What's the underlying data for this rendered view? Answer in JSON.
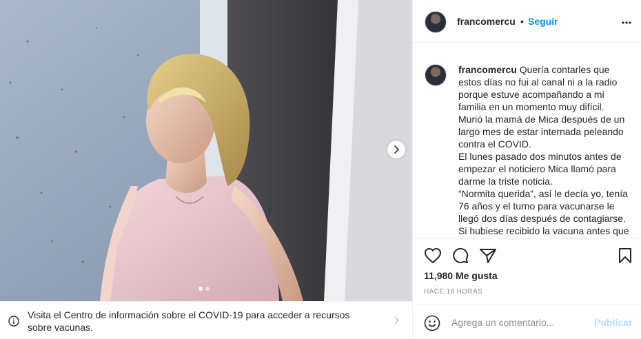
{
  "post": {
    "media": {
      "carousel_dots": 2,
      "active_dot": 0
    },
    "covid_banner": {
      "text": "Visita el Centro de información sobre el COVID-19 para acceder a recursos sobre vacunas."
    }
  },
  "header": {
    "username": "francomercu",
    "separator": "•",
    "follow_label": "Seguir"
  },
  "caption": {
    "username": "francomercu",
    "lines": [
      "Quería contarles que estos días no fui al canal ni a la radio porque estuve acompañando a mi familia en un momento muy difícil.",
      "Murió la mamá de Mica después de un largo mes de estar internada peleando contra el COVID.",
      "El lunes pasado dos minutos antes de empezar el noticiero Mica llamó para darme la triste noticia.",
      "“Normita querida”, así le decía yo, tenía 76 años y el turno para vacunarse le llegó dos días después de contagiarse.",
      "Si hubiese recibido la vacuna antes que"
    ]
  },
  "engagement": {
    "likes": "11,980 Me gusta",
    "time": "HACE 18 HORAS"
  },
  "comment": {
    "placeholder": "Agrega un comentario...",
    "publish_label": "Publicar"
  },
  "colors": {
    "accent": "#0095f6",
    "publish_disabled": "#b2dffc",
    "muted": "#8e8e8e",
    "text": "#262626",
    "border": "#efefef"
  }
}
